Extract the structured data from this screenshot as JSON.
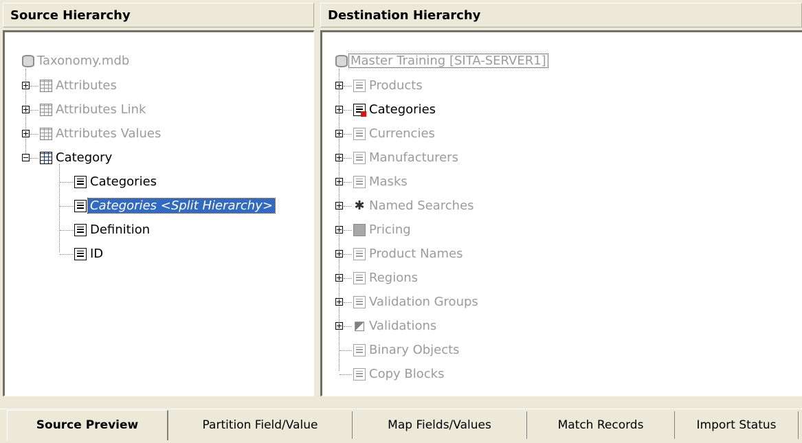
{
  "source": {
    "header": "Source Hierarchy",
    "root": "Taxonomy.mdb",
    "tables": [
      {
        "label": "Attributes",
        "expanded": false
      },
      {
        "label": "Attributes Link",
        "expanded": false
      },
      {
        "label": "Attributes Values",
        "expanded": false
      },
      {
        "label": "Category",
        "expanded": true
      }
    ],
    "category_children": [
      {
        "label": "Categories"
      },
      {
        "label": "Categories <Split Hierarchy>",
        "selected": true
      },
      {
        "label": "Definition"
      },
      {
        "label": "ID"
      }
    ]
  },
  "destination": {
    "header": "Destination Hierarchy",
    "root": "Master Training [SITA-SERVER1]",
    "tables": [
      {
        "label": "Products",
        "icon": "table-icon",
        "active": false
      },
      {
        "label": "Categories",
        "icon": "categories-table-icon",
        "active": true
      },
      {
        "label": "Currencies",
        "icon": "table-icon",
        "active": false
      },
      {
        "label": "Manufacturers",
        "icon": "table-icon",
        "active": false
      },
      {
        "label": "Masks",
        "icon": "masks-icon",
        "active": false
      },
      {
        "label": "Named Searches",
        "icon": "gear-icon",
        "active": false
      },
      {
        "label": "Pricing",
        "icon": "table-icon",
        "active": false
      },
      {
        "label": "Product Names",
        "icon": "table-icon",
        "active": false
      },
      {
        "label": "Regions",
        "icon": "table-icon",
        "active": false
      },
      {
        "label": "Validation Groups",
        "icon": "table-icon",
        "active": false
      },
      {
        "label": "Validations",
        "icon": "validations-icon",
        "active": false
      },
      {
        "label": "Binary Objects",
        "icon": "table-icon",
        "active": false,
        "leaf": true
      },
      {
        "label": "Copy Blocks",
        "icon": "table-icon",
        "active": false,
        "leaf": true
      }
    ]
  },
  "tabs": [
    {
      "label": "Source Preview",
      "active": true
    },
    {
      "label": "Partition Field/Value",
      "active": false
    },
    {
      "label": "Map Fields/Values",
      "active": false
    },
    {
      "label": "Match Records",
      "active": false
    },
    {
      "label": "Import Status",
      "active": false
    }
  ]
}
